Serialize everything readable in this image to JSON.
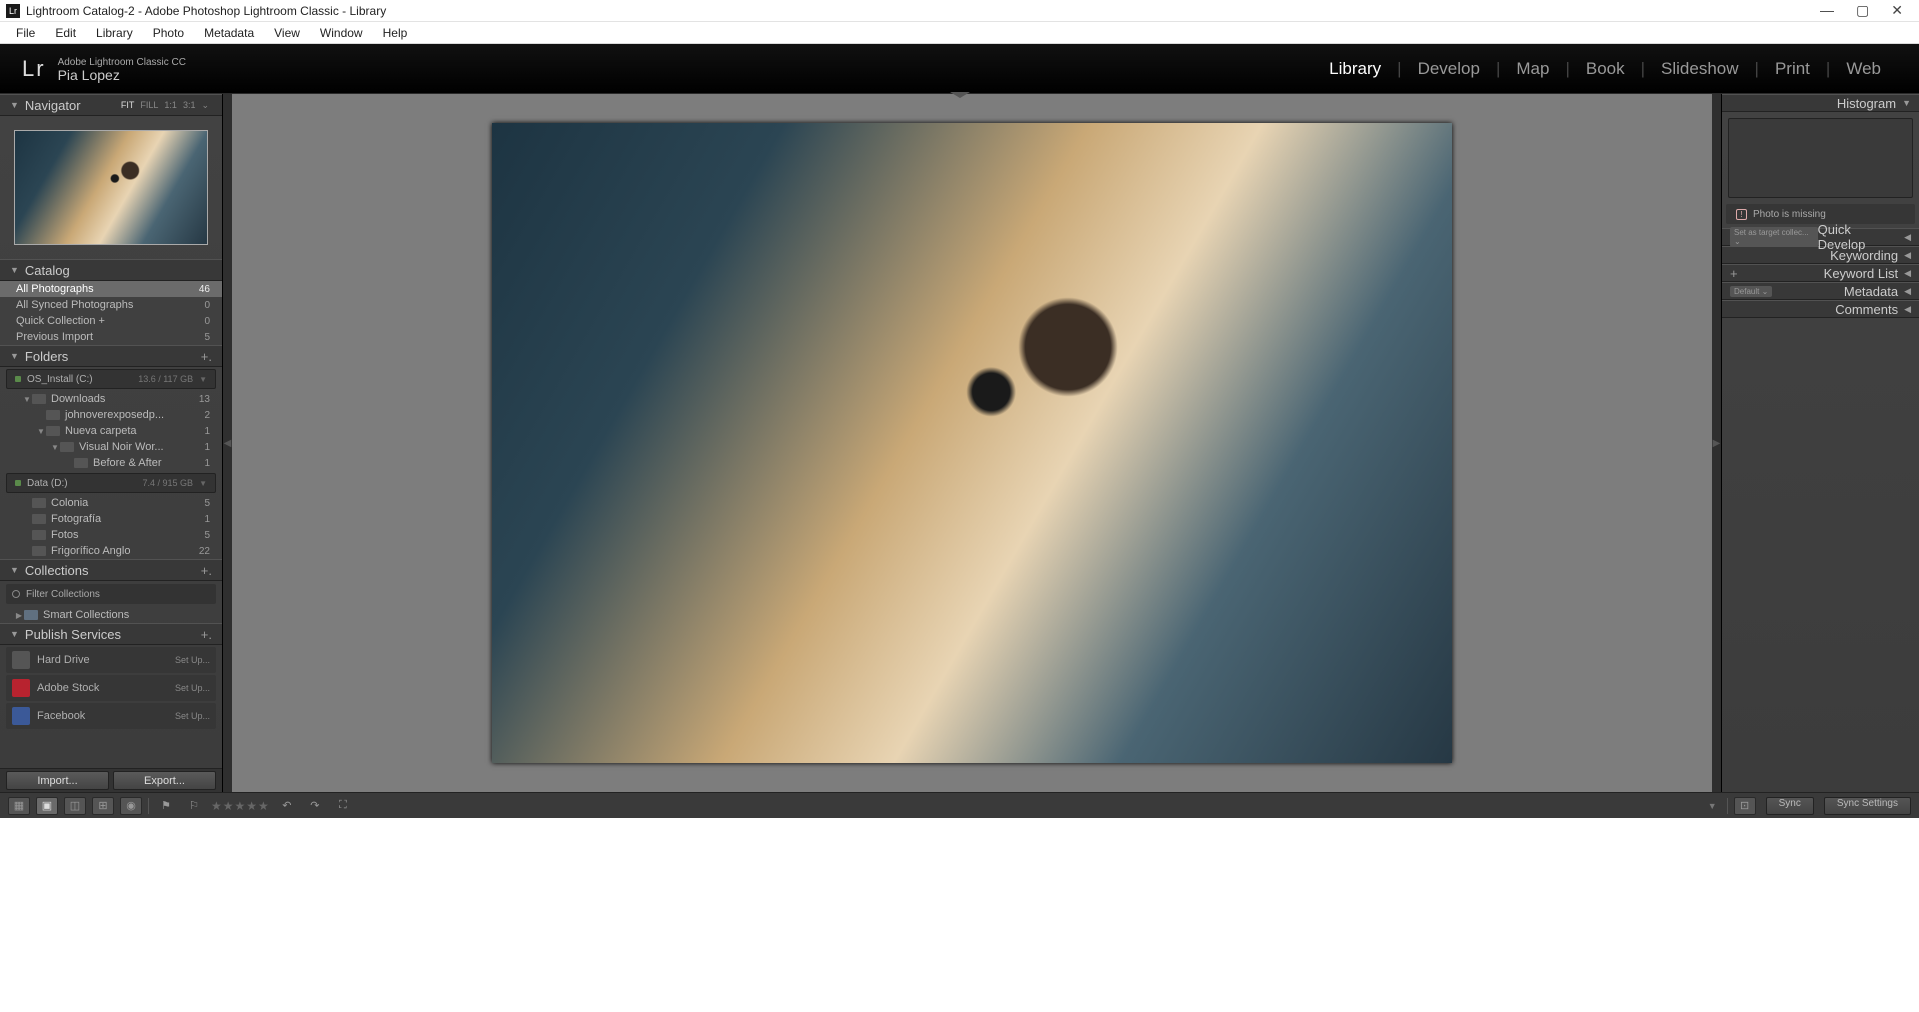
{
  "title": "Lightroom Catalog-2 - Adobe Photoshop Lightroom Classic - Library",
  "menu": [
    "File",
    "Edit",
    "Library",
    "Photo",
    "Metadata",
    "View",
    "Window",
    "Help"
  ],
  "header": {
    "appline": "Adobe Lightroom Classic CC",
    "user": "Pia Lopez"
  },
  "modules": [
    "Library",
    "Develop",
    "Map",
    "Book",
    "Slideshow",
    "Print",
    "Web"
  ],
  "active_module": "Library",
  "navigator": {
    "title": "Navigator",
    "zoom": [
      "FIT",
      "FILL",
      "1:1",
      "3:1"
    ],
    "zoom_active": "FIT"
  },
  "catalog": {
    "title": "Catalog",
    "items": [
      {
        "label": "All Photographs",
        "count": "46",
        "sel": true
      },
      {
        "label": "All Synced Photographs",
        "count": "0"
      },
      {
        "label": "Quick Collection  +",
        "count": "0"
      },
      {
        "label": "Previous Import",
        "count": "5"
      }
    ]
  },
  "folders": {
    "title": "Folders",
    "volumes": [
      {
        "name": "OS_Install (C:)",
        "size": "13.6 / 117 GB",
        "tree": [
          {
            "ind": 1,
            "exp": "▼",
            "label": "Downloads",
            "count": "13"
          },
          {
            "ind": 2,
            "exp": "",
            "label": "johnoverexposedp...",
            "count": "2"
          },
          {
            "ind": 2,
            "exp": "▼",
            "label": "Nueva carpeta",
            "count": "1"
          },
          {
            "ind": 3,
            "exp": "▼",
            "label": "Visual Noir Wor...",
            "count": "1"
          },
          {
            "ind": 4,
            "exp": "",
            "label": "Before & After",
            "count": "1"
          }
        ]
      },
      {
        "name": "Data (D:)",
        "size": "7.4 / 915 GB",
        "tree": [
          {
            "ind": 1,
            "exp": "",
            "label": "Colonia",
            "count": "5"
          },
          {
            "ind": 1,
            "exp": "",
            "label": "Fotografía",
            "count": "1"
          },
          {
            "ind": 1,
            "exp": "",
            "label": "Fotos",
            "count": "5"
          },
          {
            "ind": 1,
            "exp": "",
            "label": "Frigorífico Anglo",
            "count": "22"
          }
        ]
      }
    ]
  },
  "collections": {
    "title": "Collections",
    "filter": "Filter Collections",
    "items": [
      {
        "label": "Smart Collections"
      }
    ]
  },
  "publish": {
    "title": "Publish Services",
    "items": [
      {
        "label": "Hard Drive",
        "cls": "",
        "action": "Set Up..."
      },
      {
        "label": "Adobe Stock",
        "cls": "st",
        "action": "Set Up..."
      },
      {
        "label": "Facebook",
        "cls": "fb",
        "action": "Set Up..."
      }
    ]
  },
  "import": {
    "import": "Import...",
    "export": "Export..."
  },
  "right": {
    "histogram": "Histogram",
    "missing": "Photo is missing",
    "panels": [
      {
        "label": "Quick Develop",
        "pill": "Set as target collec... ⌄"
      },
      {
        "label": "Keywording"
      },
      {
        "label": "Keyword List",
        "plus": true
      },
      {
        "label": "Metadata",
        "pill": "Default                    ⌄"
      },
      {
        "label": "Comments"
      }
    ]
  },
  "bottom": {
    "sync": "Sync",
    "syncset": "Sync Settings"
  }
}
